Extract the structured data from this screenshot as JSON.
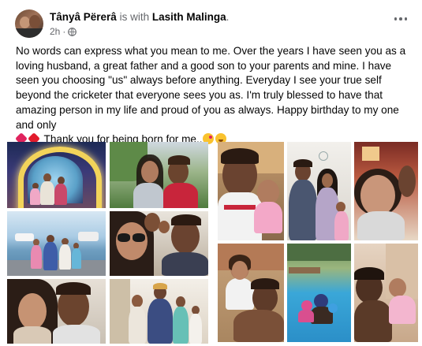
{
  "post": {
    "author": "Tânyâ Përerâ",
    "with_text": "is with",
    "tagged": "Lasith Malinga",
    "tagged_suffix": ".",
    "time": "2h",
    "dot": "·",
    "text_main": "No words can express what you mean to me. Over the years I have seen you as a loving husband, a great father and a good son to your parents and mine. I have seen you choosing \"us\" always before anything. Everyday I see your true self beyond the cricketer that everyone sees you as. I'm truly blessed to have that amazing person in my life and proud of you as always. Happy birthday to my one and only",
    "text_end": "Thank you for being born for me..",
    "icons": {
      "privacy": "globe-icon",
      "menu": "more-options-icon",
      "emojis": [
        "sparkling-heart-emoji",
        "red-heart-emoji",
        "face-blowing-kiss-emoji",
        "grinning-face-emoji"
      ]
    }
  },
  "photos": [
    {
      "name": "photo-lantern-arch-family"
    },
    {
      "name": "photo-couple-park-selfie"
    },
    {
      "name": "photo-family-harbour"
    },
    {
      "name": "photo-family-selfie-sunglasses"
    },
    {
      "name": "photo-couple-selfie-close"
    },
    {
      "name": "photo-family-indoor-group"
    },
    {
      "name": "photo-father-baby-closeup"
    },
    {
      "name": "photo-family-indoor-standing"
    },
    {
      "name": "photo-girl-selfie"
    },
    {
      "name": "photo-father-daughter-sofa"
    },
    {
      "name": "photo-family-pool"
    },
    {
      "name": "photo-father-baby-lying"
    }
  ],
  "colors": {
    "text": "#050505",
    "secondary": "#65676b"
  }
}
